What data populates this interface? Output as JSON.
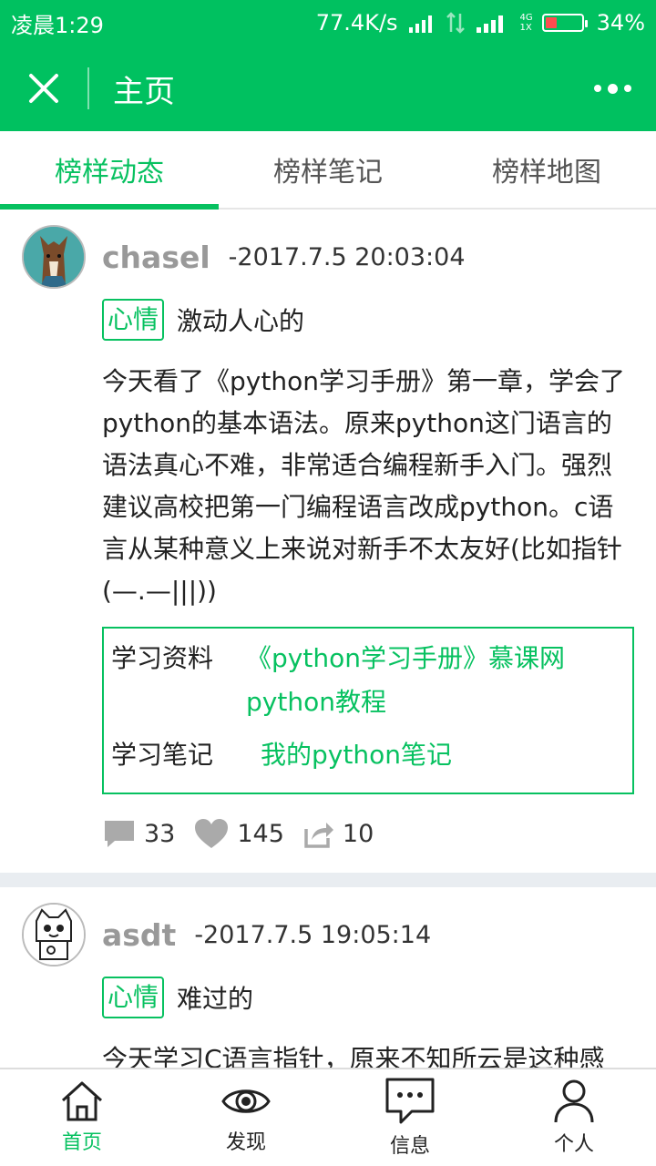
{
  "status_bar": {
    "time": "凌晨1:29",
    "network_speed": "77.4K/s",
    "network_type": "4G",
    "sim_label": "1X",
    "battery": "34%"
  },
  "top_bar": {
    "title": "主页",
    "close_icon": "close-icon",
    "more_icon": "more-icon"
  },
  "tabs": [
    {
      "label": "榜样动态",
      "active": true
    },
    {
      "label": "榜样笔记",
      "active": false
    },
    {
      "label": "榜样地图",
      "active": false
    }
  ],
  "posts": [
    {
      "username": "chasel",
      "time": "-2017.7.5 20:03:04",
      "mood_tag": "心情",
      "mood": "激动人心的",
      "content": "今天看了《python学习手册》第一章，学会了python的基本语法。原来python这门语言的语法真心不难，非常适合编程新手入门。强烈建议高校把第一门编程语言改成python。c语言从某种意义上来说对新手不太友好(比如指针(—.—|||))",
      "resources": {
        "materials_label": "学习资料",
        "materials_link1": "《python学习手册》慕课网",
        "materials_link2": "python教程",
        "notes_label": "学习笔记",
        "notes_link": "我的python笔记"
      },
      "comments": "33",
      "likes": "145",
      "shares": "10"
    },
    {
      "username": "asdt",
      "time": "-2017.7.5 19:05:14",
      "mood_tag": "心情",
      "mood": "难过的",
      "content": "今天学习C语言指针，原来不知所云是这种感觉/(ㄒoㄒ)/~~"
    }
  ],
  "bottom_nav": [
    {
      "label": "首页",
      "icon": "home-icon",
      "active": true
    },
    {
      "label": "发现",
      "icon": "eye-icon",
      "active": false
    },
    {
      "label": "信息",
      "icon": "message-icon",
      "active": false
    },
    {
      "label": "个人",
      "icon": "person-icon",
      "active": false
    }
  ],
  "colors": {
    "primary": "#07c160",
    "divider": "#e9edf1"
  }
}
